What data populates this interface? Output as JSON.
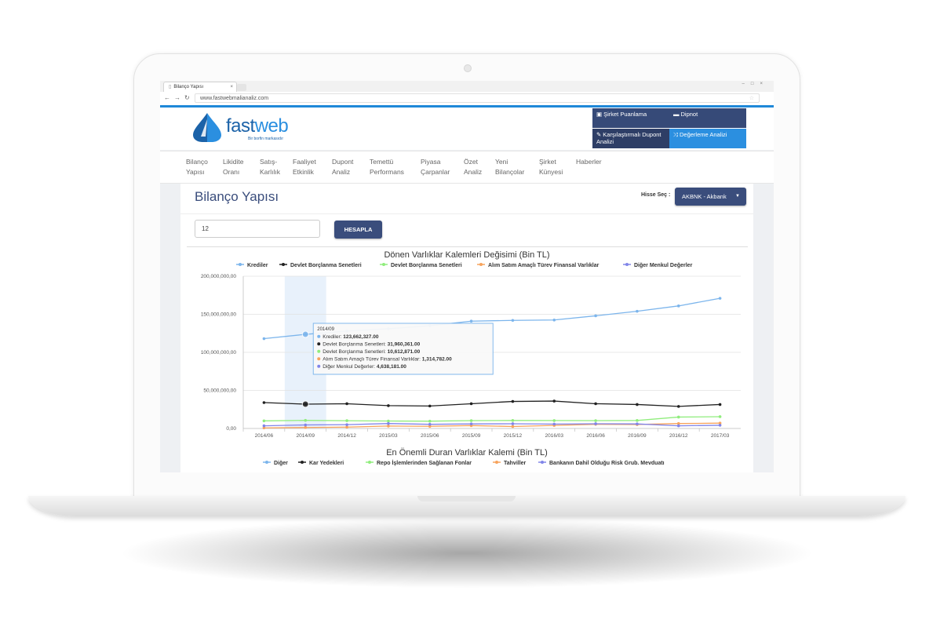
{
  "browser": {
    "tab_title": "Bilanço Yapısı",
    "tab_close": "×",
    "url": "www.fastwebmalianaliz.com"
  },
  "site": {
    "logo_text_a": "fast",
    "logo_text_b": "web",
    "tagline": "Bir borfin markasıdır",
    "brand_color": "#2b8fe0",
    "dark_color": "#3a4d7c"
  },
  "quick_links": [
    {
      "label": "Şirket Puanlama",
      "icon": "briefcase-icon"
    },
    {
      "label": "Dipnot",
      "icon": "comment-icon"
    },
    {
      "label": "Karşılaştırmalı Dupont Analizi",
      "icon": "tools-icon"
    },
    {
      "label": "Değerleme Analizi",
      "icon": "shuffle-icon"
    }
  ],
  "menu": [
    "Bilanço\nYapısı",
    "Likidite\nOranı",
    "Satış-\nKarlılık",
    "Faaliyet\nEtkinlik",
    "Dupont\nAnaliz",
    "Temettü\nPerformans",
    "Piyasa\nÇarpanlar",
    "Özet\nAnaliz",
    "Yeni\nBilançolar",
    "Şirket\nKünyesi",
    "Haberler"
  ],
  "page": {
    "title": "Bilanço Yapısı",
    "hisse_label": "Hisse Seç :",
    "hisse_value": "AKBNK - Akbank",
    "input_value": "12",
    "button_label": "HESAPLA"
  },
  "chart_data": [
    {
      "type": "line",
      "title": "Dönen Varlıklar Kalemleri Değisimi (Bin TL)",
      "x": [
        "2014/06",
        "2014/09",
        "2014/12",
        "2015/03",
        "2015/06",
        "2015/09",
        "2015/12",
        "2016/03",
        "2016/06",
        "2016/09",
        "2016/12",
        "2017/03"
      ],
      "yticks": [
        "0,00",
        "50,000,000,00",
        "100,000,000,00",
        "150,000,000,00",
        "200,000,000,00"
      ],
      "ylim": [
        0,
        200000000
      ],
      "grid": true,
      "legend": "top",
      "series": [
        {
          "name": "Krediler",
          "color": "#7cb5ec",
          "values": [
            118000000,
            123662327,
            128000000,
            131000000,
            135000000,
            141000000,
            142000000,
            142500000,
            148000000,
            154000000,
            161000000,
            171000000
          ]
        },
        {
          "name": "Devlet Borçlanma Senetleri",
          "color": "#222222",
          "values": [
            34000000,
            31960361,
            32500000,
            30000000,
            29500000,
            32500000,
            35500000,
            36000000,
            32500000,
            31500000,
            29000000,
            31500000
          ]
        },
        {
          "name": "Devlet Borçlanma Senetleri",
          "color": "#90ed7d",
          "values": [
            10000000,
            10612871,
            10200000,
            9800000,
            9600000,
            10300000,
            10500000,
            10400000,
            10300000,
            10500000,
            15000000,
            15500000
          ]
        },
        {
          "name": "Alım Satım Amaçlı Türev Finansal Varlıklar",
          "color": "#f7a35c",
          "values": [
            800000,
            1314782,
            1800000,
            3200000,
            2800000,
            3800000,
            2600000,
            4000000,
            5500000,
            5200000,
            6500000,
            7000000
          ]
        },
        {
          "name": "Diğer Menkul Değerler",
          "color": "#8085e9",
          "values": [
            3500000,
            4638181,
            5000000,
            6500000,
            5500000,
            6000000,
            6200000,
            5800000,
            6200000,
            6000000,
            3500000,
            4200000
          ]
        }
      ],
      "tooltip": {
        "header": "2014/09",
        "rows": [
          {
            "label": "Krediler:",
            "value": "123,662,327.00",
            "color": "#7cb5ec"
          },
          {
            "label": "Devlet Borçlanma Senetleri:",
            "value": "31,960,361.00",
            "color": "#222222"
          },
          {
            "label": "Devlet Borçlanma Senetleri:",
            "value": "10,612,871.00",
            "color": "#90ed7d"
          },
          {
            "label": "Alım Satım Amaçlı Türev Finansal Varlıklar:",
            "value": "1,314,782.00",
            "color": "#f7a35c"
          },
          {
            "label": "Diğer Menkul Değerler:",
            "value": "4,638,181.00",
            "color": "#8085e9"
          }
        ]
      }
    },
    {
      "type": "line",
      "title": "En Önemli Duran Varlıklar Kalemi (Bin TL)",
      "legend": "top",
      "series": [
        {
          "name": "Diğer",
          "color": "#7cb5ec"
        },
        {
          "name": "Kar Yedekleri",
          "color": "#222222"
        },
        {
          "name": "Repo İşlemlerinden Sağlanan Fonlar",
          "color": "#90ed7d"
        },
        {
          "name": "Tahviller",
          "color": "#f7a35c"
        },
        {
          "name": "Bankanın Dahil Olduğu Risk Grub. Mevduatı",
          "color": "#8085e9"
        }
      ]
    }
  ]
}
